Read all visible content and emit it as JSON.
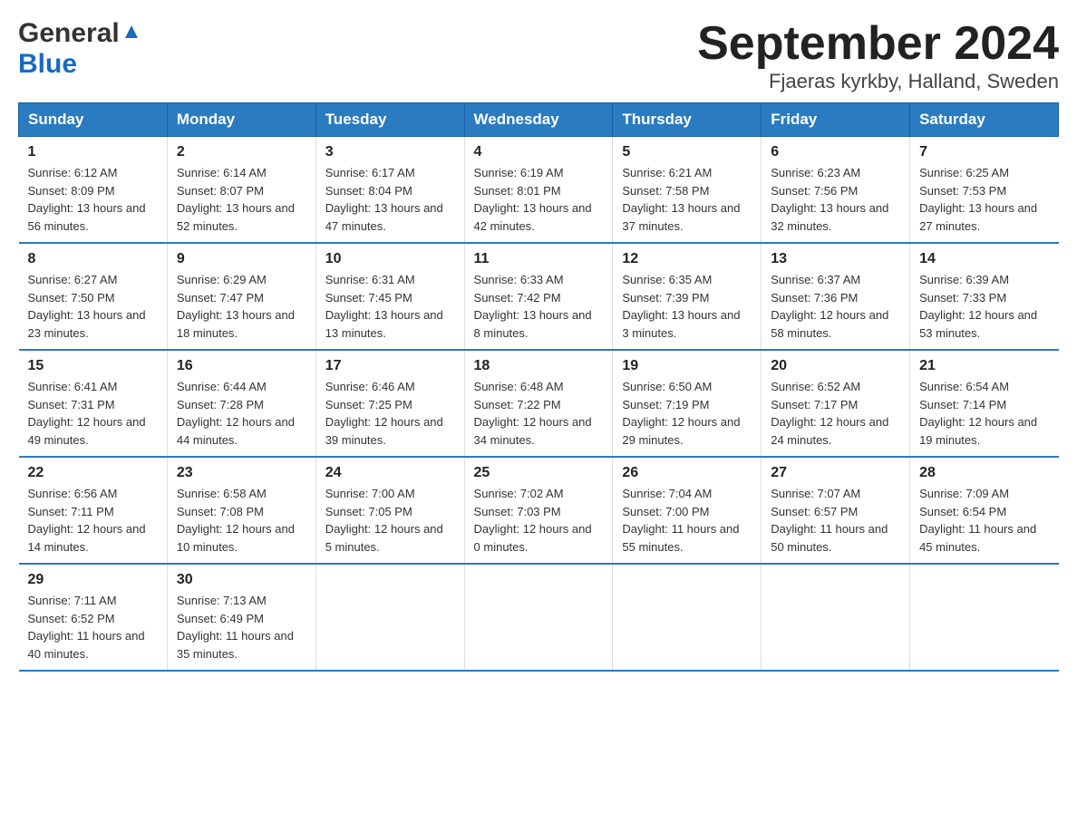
{
  "header": {
    "logo_general": "General",
    "logo_blue": "Blue",
    "month_title": "September 2024",
    "location": "Fjaeras kyrkby, Halland, Sweden"
  },
  "weekdays": [
    "Sunday",
    "Monday",
    "Tuesday",
    "Wednesday",
    "Thursday",
    "Friday",
    "Saturday"
  ],
  "weeks": [
    [
      {
        "day": "1",
        "sunrise": "6:12 AM",
        "sunset": "8:09 PM",
        "daylight": "13 hours and 56 minutes."
      },
      {
        "day": "2",
        "sunrise": "6:14 AM",
        "sunset": "8:07 PM",
        "daylight": "13 hours and 52 minutes."
      },
      {
        "day": "3",
        "sunrise": "6:17 AM",
        "sunset": "8:04 PM",
        "daylight": "13 hours and 47 minutes."
      },
      {
        "day": "4",
        "sunrise": "6:19 AM",
        "sunset": "8:01 PM",
        "daylight": "13 hours and 42 minutes."
      },
      {
        "day": "5",
        "sunrise": "6:21 AM",
        "sunset": "7:58 PM",
        "daylight": "13 hours and 37 minutes."
      },
      {
        "day": "6",
        "sunrise": "6:23 AM",
        "sunset": "7:56 PM",
        "daylight": "13 hours and 32 minutes."
      },
      {
        "day": "7",
        "sunrise": "6:25 AM",
        "sunset": "7:53 PM",
        "daylight": "13 hours and 27 minutes."
      }
    ],
    [
      {
        "day": "8",
        "sunrise": "6:27 AM",
        "sunset": "7:50 PM",
        "daylight": "13 hours and 23 minutes."
      },
      {
        "day": "9",
        "sunrise": "6:29 AM",
        "sunset": "7:47 PM",
        "daylight": "13 hours and 18 minutes."
      },
      {
        "day": "10",
        "sunrise": "6:31 AM",
        "sunset": "7:45 PM",
        "daylight": "13 hours and 13 minutes."
      },
      {
        "day": "11",
        "sunrise": "6:33 AM",
        "sunset": "7:42 PM",
        "daylight": "13 hours and 8 minutes."
      },
      {
        "day": "12",
        "sunrise": "6:35 AM",
        "sunset": "7:39 PM",
        "daylight": "13 hours and 3 minutes."
      },
      {
        "day": "13",
        "sunrise": "6:37 AM",
        "sunset": "7:36 PM",
        "daylight": "12 hours and 58 minutes."
      },
      {
        "day": "14",
        "sunrise": "6:39 AM",
        "sunset": "7:33 PM",
        "daylight": "12 hours and 53 minutes."
      }
    ],
    [
      {
        "day": "15",
        "sunrise": "6:41 AM",
        "sunset": "7:31 PM",
        "daylight": "12 hours and 49 minutes."
      },
      {
        "day": "16",
        "sunrise": "6:44 AM",
        "sunset": "7:28 PM",
        "daylight": "12 hours and 44 minutes."
      },
      {
        "day": "17",
        "sunrise": "6:46 AM",
        "sunset": "7:25 PM",
        "daylight": "12 hours and 39 minutes."
      },
      {
        "day": "18",
        "sunrise": "6:48 AM",
        "sunset": "7:22 PM",
        "daylight": "12 hours and 34 minutes."
      },
      {
        "day": "19",
        "sunrise": "6:50 AM",
        "sunset": "7:19 PM",
        "daylight": "12 hours and 29 minutes."
      },
      {
        "day": "20",
        "sunrise": "6:52 AM",
        "sunset": "7:17 PM",
        "daylight": "12 hours and 24 minutes."
      },
      {
        "day": "21",
        "sunrise": "6:54 AM",
        "sunset": "7:14 PM",
        "daylight": "12 hours and 19 minutes."
      }
    ],
    [
      {
        "day": "22",
        "sunrise": "6:56 AM",
        "sunset": "7:11 PM",
        "daylight": "12 hours and 14 minutes."
      },
      {
        "day": "23",
        "sunrise": "6:58 AM",
        "sunset": "7:08 PM",
        "daylight": "12 hours and 10 minutes."
      },
      {
        "day": "24",
        "sunrise": "7:00 AM",
        "sunset": "7:05 PM",
        "daylight": "12 hours and 5 minutes."
      },
      {
        "day": "25",
        "sunrise": "7:02 AM",
        "sunset": "7:03 PM",
        "daylight": "12 hours and 0 minutes."
      },
      {
        "day": "26",
        "sunrise": "7:04 AM",
        "sunset": "7:00 PM",
        "daylight": "11 hours and 55 minutes."
      },
      {
        "day": "27",
        "sunrise": "7:07 AM",
        "sunset": "6:57 PM",
        "daylight": "11 hours and 50 minutes."
      },
      {
        "day": "28",
        "sunrise": "7:09 AM",
        "sunset": "6:54 PM",
        "daylight": "11 hours and 45 minutes."
      }
    ],
    [
      {
        "day": "29",
        "sunrise": "7:11 AM",
        "sunset": "6:52 PM",
        "daylight": "11 hours and 40 minutes."
      },
      {
        "day": "30",
        "sunrise": "7:13 AM",
        "sunset": "6:49 PM",
        "daylight": "11 hours and 35 minutes."
      },
      null,
      null,
      null,
      null,
      null
    ]
  ],
  "labels": {
    "sunrise": "Sunrise:",
    "sunset": "Sunset:",
    "daylight": "Daylight:"
  }
}
